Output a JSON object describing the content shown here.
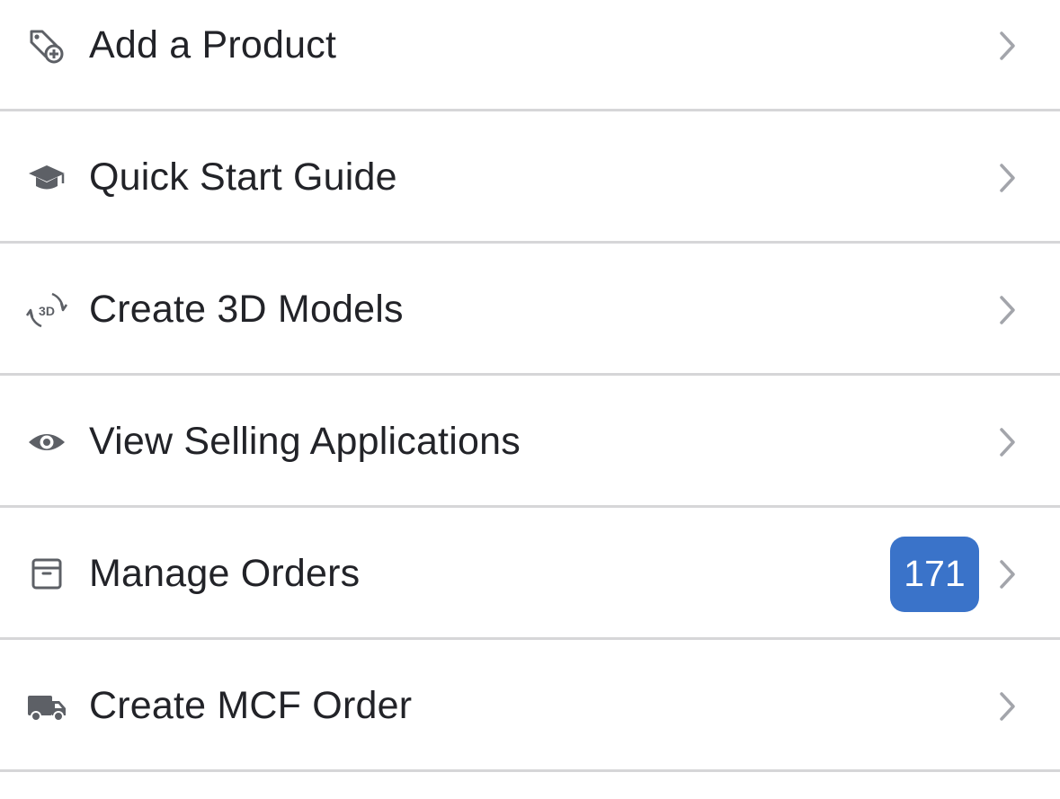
{
  "menu": {
    "items": [
      {
        "label": "Add a Product",
        "icon": "tag-plus-icon"
      },
      {
        "label": "Quick Start Guide",
        "icon": "graduation-cap-icon"
      },
      {
        "label": "Create 3D Models",
        "icon": "3d-rotate-icon",
        "icon_text": "3D"
      },
      {
        "label": "View Selling Applications",
        "icon": "eye-icon"
      },
      {
        "label": "Manage Orders",
        "icon": "archive-box-icon",
        "badge": "171"
      },
      {
        "label": "Create MCF Order",
        "icon": "truck-icon"
      }
    ]
  },
  "colors": {
    "background": "#ffffff",
    "text": "#222328",
    "icon": "#5d6066",
    "chevron": "#a3a5ab",
    "divider": "#d6d6d8",
    "badge": "#3a73c9"
  }
}
